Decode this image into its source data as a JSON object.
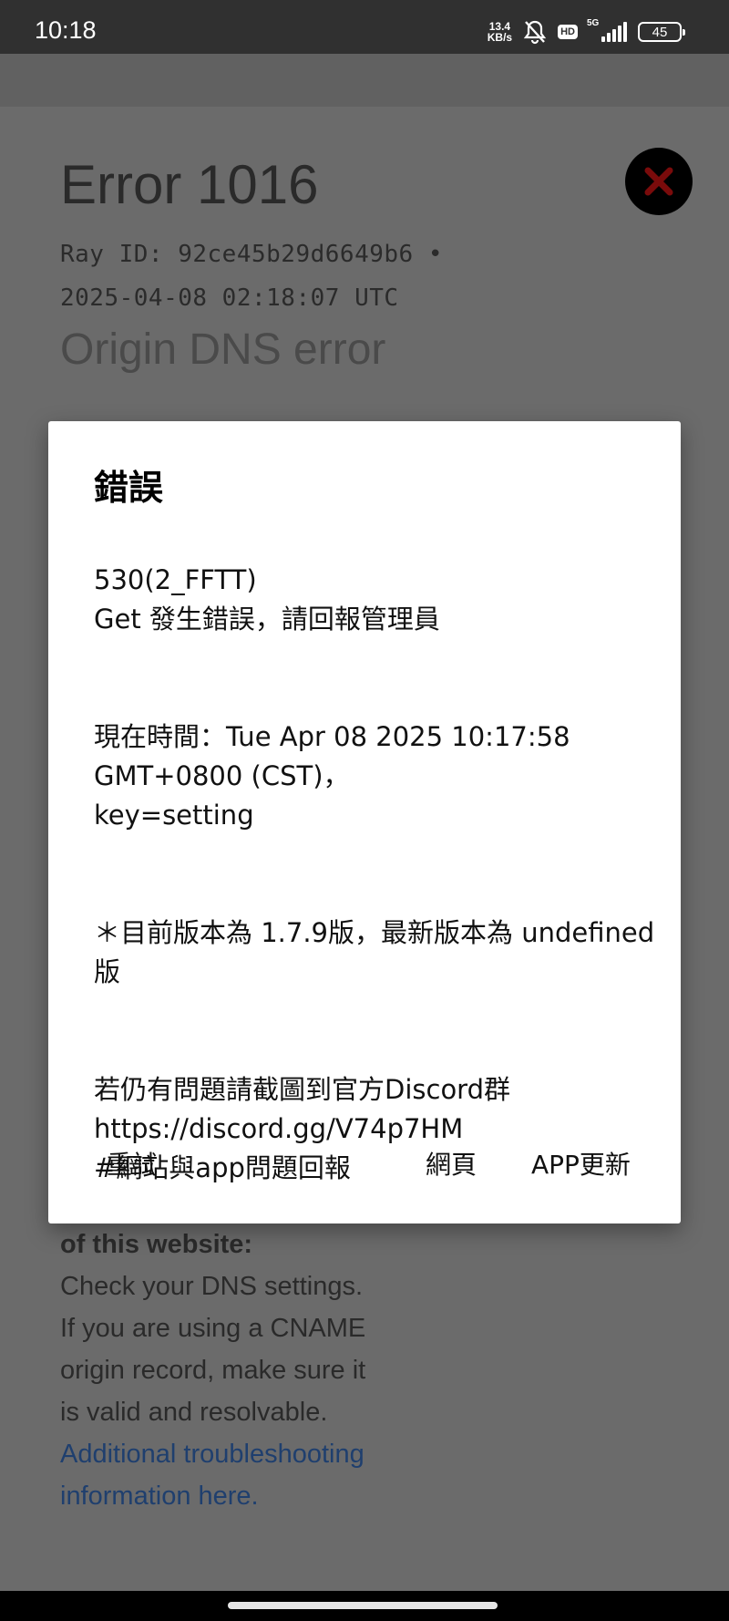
{
  "status_bar": {
    "time": "10:18",
    "net_speed_value": "13.4",
    "net_speed_unit": "KB/s",
    "hd_badge": "HD",
    "network_type": "5G",
    "battery_level": "45",
    "icons": [
      "bell-muted-icon",
      "signal-icon",
      "battery-icon"
    ]
  },
  "background_page": {
    "error_title": "Error 1016",
    "ray_id_line": "Ray ID: 92ce45b29d6649b6 •",
    "timestamp_line": "2025-04-08 02:18:07 UTC",
    "subtitle": "Origin DNS error",
    "owner_heading": "of this website:",
    "instructions": "Check your DNS settings. If you are using a CNAME origin record, make sure it is valid and resolvable.",
    "link_text": "Additional troubleshooting information here.",
    "close_icon": "close-x-icon",
    "colors": {
      "close_x": "#7a0b0b",
      "link": "#1f3f6e"
    }
  },
  "dialog": {
    "title": "錯誤",
    "body_lines": [
      "530(2_FFTT)\nGet 發生錯誤，請回報管理員",
      "現在時間：Tue Apr 08 2025 10:17:58 GMT+0800 (CST)，\nkey=setting",
      " ＊目前版本為 1.7.9版，最新版本為 undefined版",
      "若仍有問題請截圖到官方Discord群\nhttps://discord.gg/V74p7HM\n#網站與app問題回報"
    ],
    "retry_label": "重試",
    "webpage_label": "網頁",
    "update_label": "APP更新"
  }
}
